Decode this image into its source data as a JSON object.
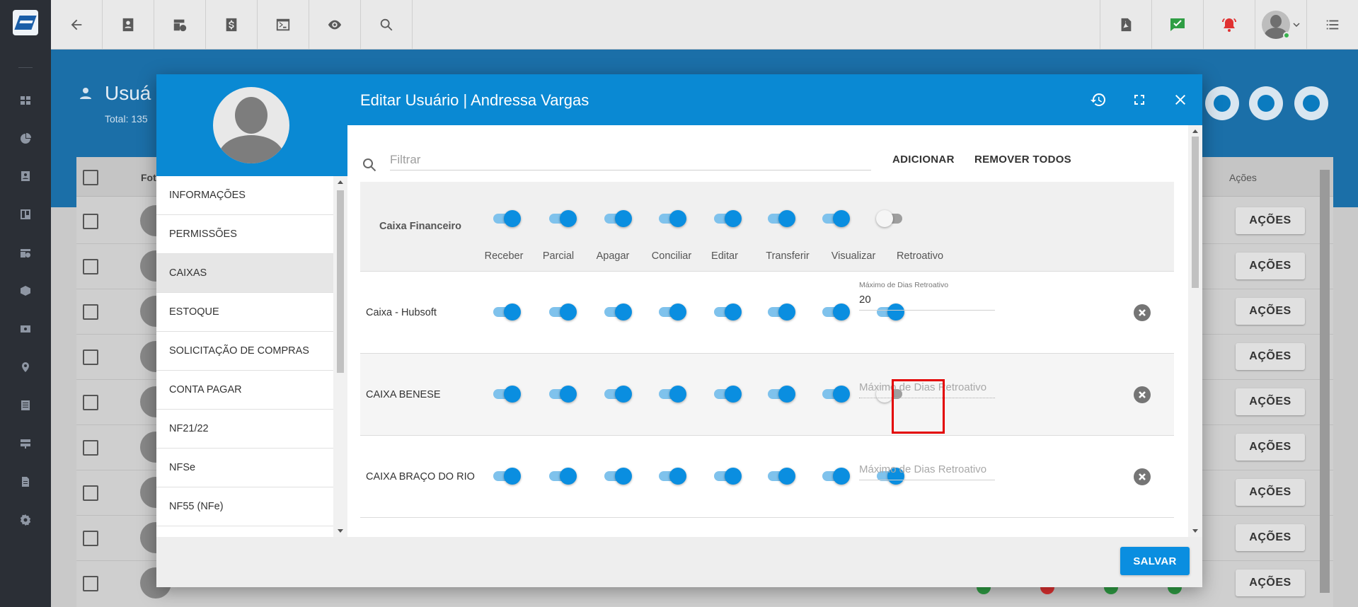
{
  "rail": {
    "icons": [
      "dashboard-icon",
      "pie-chart-icon",
      "contact-card-icon",
      "board-icon",
      "calendar-clock-icon",
      "package-icon",
      "money-icon",
      "map-pin-icon",
      "list-icon",
      "server-icon",
      "document-icon",
      "settings-icon"
    ]
  },
  "topbar": {
    "left_icons": [
      "back-arrow-icon",
      "contact-card-icon",
      "calendar-clock-icon",
      "dollar-icon",
      "terminal-icon",
      "eye-icon",
      "search-icon"
    ],
    "right_icons": [
      "pdf-icon",
      "chat-check-icon",
      "alarm-bell-icon",
      "avatar",
      "menu-lines-icon"
    ]
  },
  "background": {
    "page_title": "Usuá",
    "total": "Total: 135",
    "col_foto": "Fot",
    "col_acoes": "Ações",
    "row_button": "AÇÕES"
  },
  "modal": {
    "title": "Editar Usuário | Andressa Vargas",
    "menu": [
      "INFORMAÇÕES",
      "PERMISSÕES",
      "CAIXAS",
      "ESTOQUE",
      "SOLICITAÇÃO DE COMPRAS",
      "CONTA PAGAR",
      "NF21/22",
      "NFSe",
      "NF55 (NFe)"
    ],
    "active_menu": "CAIXAS",
    "filter_placeholder": "Filtrar",
    "add_label": "ADICIONAR",
    "remove_all_label": "REMOVER TODOS",
    "save_label": "SALVAR",
    "header_row": {
      "label": "Caixa Financeiro",
      "columns": [
        "Receber",
        "Parcial",
        "Apagar",
        "Conciliar",
        "Editar",
        "Transferir",
        "Visualizar",
        "Retroativo"
      ],
      "toggles": [
        true,
        true,
        true,
        true,
        true,
        true,
        true,
        false
      ]
    },
    "max_days_label": "Máximo de Dias Retroativo",
    "rows": [
      {
        "name": "Caixa - Hubsoft",
        "toggles": [
          true,
          true,
          true,
          true,
          true,
          true,
          true,
          true
        ],
        "max_days": "20"
      },
      {
        "name": "CAIXA BENESE",
        "toggles": [
          true,
          true,
          true,
          true,
          true,
          true,
          true,
          false
        ],
        "max_days": ""
      },
      {
        "name": "CAIXA BRAÇO DO RIO",
        "toggles": [
          true,
          true,
          true,
          true,
          true,
          true,
          true,
          true
        ],
        "max_days": ""
      }
    ]
  },
  "colors": {
    "primary": "#0a89d3",
    "toggle_on": "#0a8ee0",
    "highlight": "#e30000"
  }
}
